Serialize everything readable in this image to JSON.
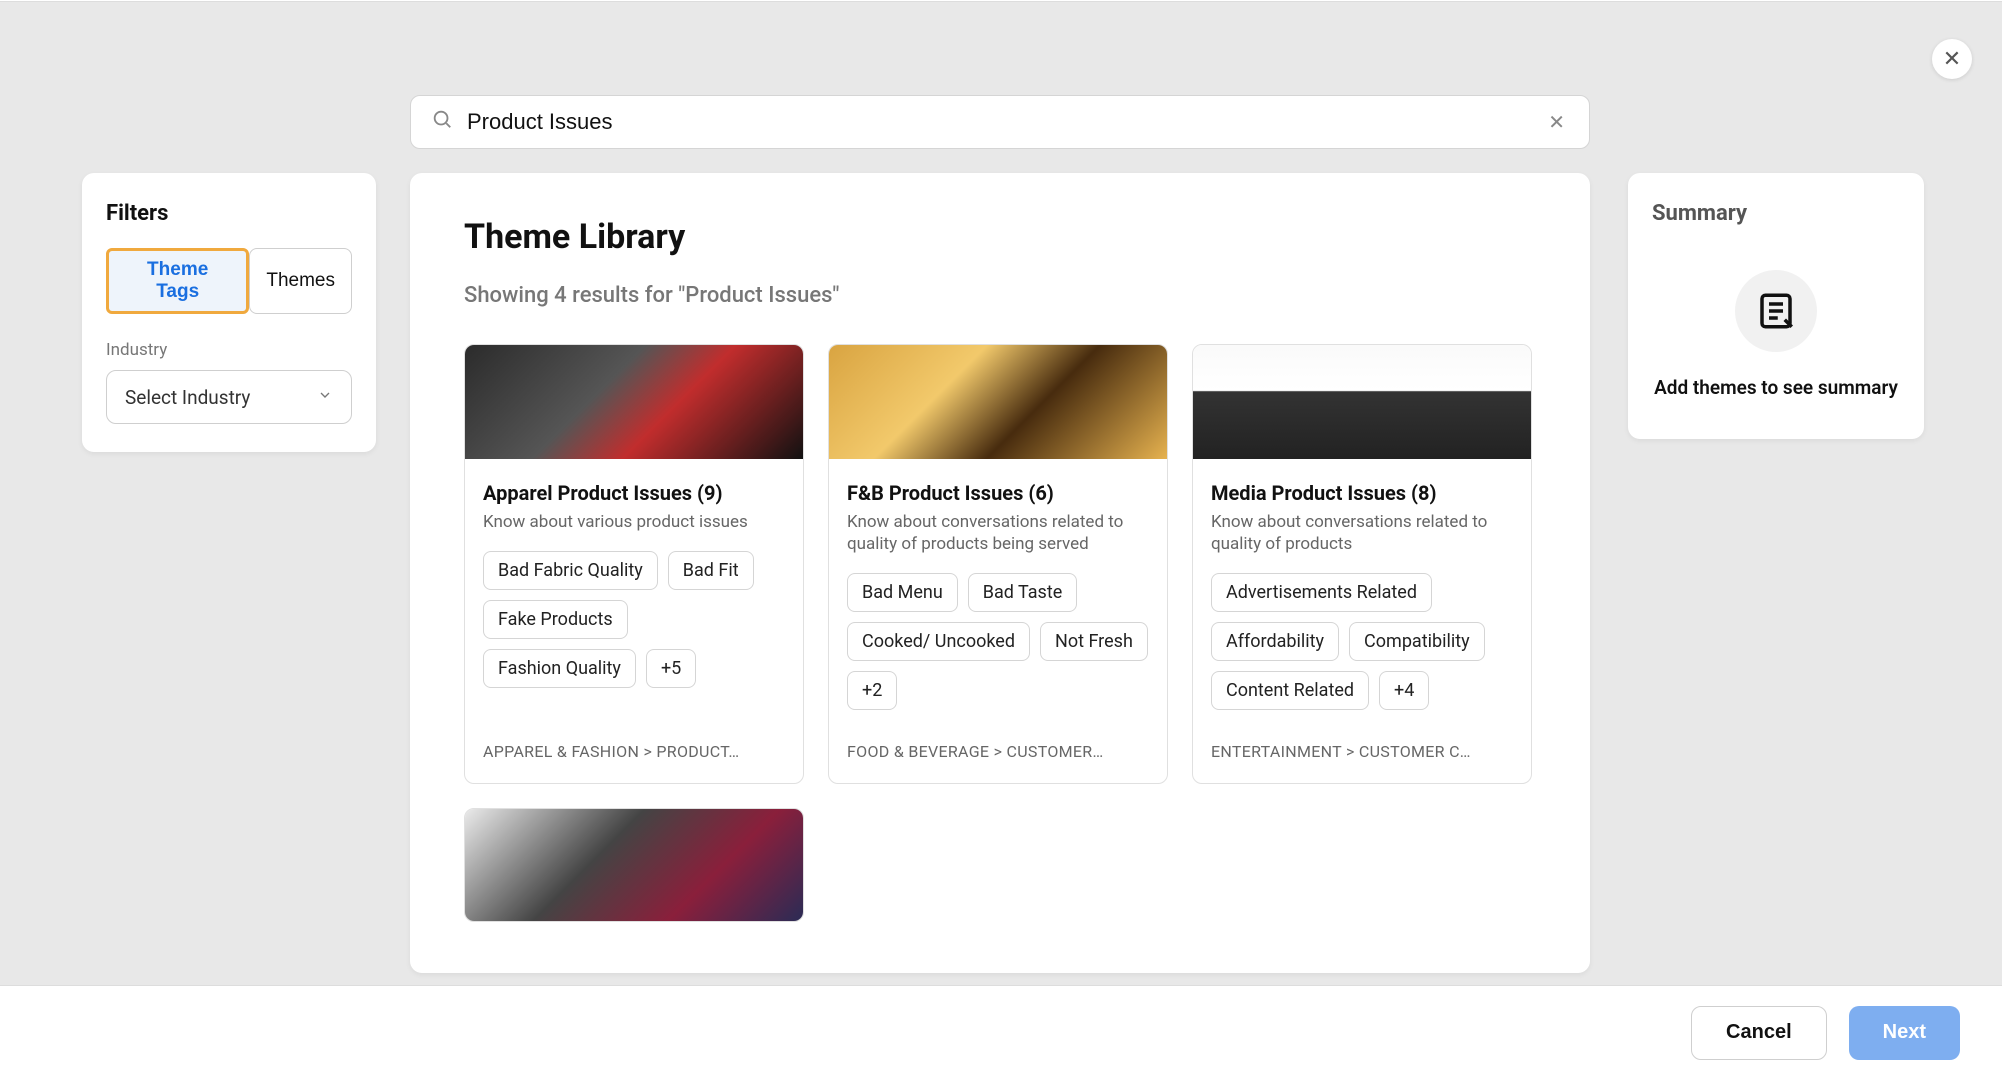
{
  "close_label": "✕",
  "search": {
    "value": "Product Issues",
    "clear_label": "✕"
  },
  "filters": {
    "title": "Filters",
    "tabs": [
      {
        "label": "Theme Tags",
        "active": true
      },
      {
        "label": "Themes",
        "active": false
      }
    ],
    "industry_label": "Industry",
    "industry_placeholder": "Select Industry"
  },
  "library": {
    "title": "Theme Library",
    "results_text": "Showing 4 results for \"Product Issues\"",
    "cards": [
      {
        "title": "Apparel Product Issues (9)",
        "desc": "Know about various product issues",
        "tags": [
          "Bad Fabric Quality",
          "Bad Fit",
          "Fake Products",
          "Fashion Quality",
          "+5"
        ],
        "path": "APPAREL & FASHION > PRODUCT…",
        "img": "img-apparel"
      },
      {
        "title": "F&B Product Issues (6)",
        "desc": "Know about conversations related to quality of products being served",
        "tags": [
          "Bad Menu",
          "Bad Taste",
          "Cooked/ Uncooked",
          "Not Fresh",
          "+2"
        ],
        "path": "FOOD & BEVERAGE > CUSTOMER…",
        "img": "img-fnb"
      },
      {
        "title": "Media Product Issues (8)",
        "desc": "Know about conversations related to quality of products",
        "tags": [
          "Advertisements Related",
          "Affordability",
          "Compatibility",
          "Content Related",
          "+4"
        ],
        "path": "ENTERTAINMENT > CUSTOMER C…",
        "img": "img-media"
      },
      {
        "title": "",
        "desc": "",
        "tags": [],
        "path": "",
        "img": "img-apparel2",
        "short": true
      }
    ]
  },
  "summary": {
    "title": "Summary",
    "message": "Add themes to see summary"
  },
  "footer": {
    "cancel": "Cancel",
    "next": "Next"
  }
}
